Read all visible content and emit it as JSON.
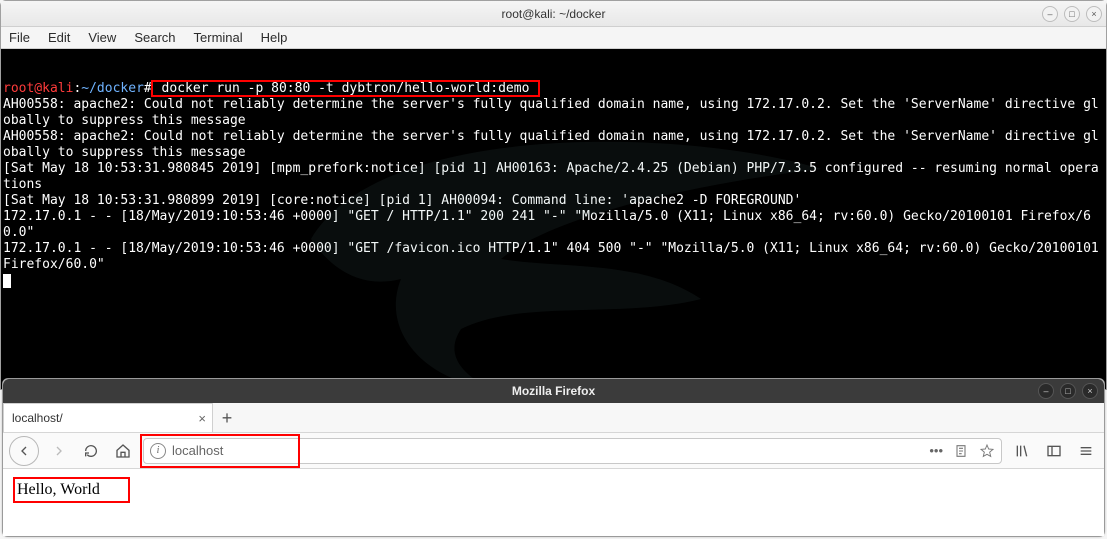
{
  "terminal": {
    "title": "root@kali: ~/docker",
    "menu": [
      "File",
      "Edit",
      "View",
      "Search",
      "Terminal",
      "Help"
    ],
    "prompt": {
      "user": "root@kali",
      "colon": ":",
      "path": "~/docker",
      "hash": "#"
    },
    "command": " docker run -p 80:80 -t dybtron/hello-world:demo ",
    "output_lines": [
      "AH00558: apache2: Could not reliably determine the server's fully qualified domain name, using 172.17.0.2. Set the 'ServerName' directive globally to suppress this message",
      "AH00558: apache2: Could not reliably determine the server's fully qualified domain name, using 172.17.0.2. Set the 'ServerName' directive globally to suppress this message",
      "[Sat May 18 10:53:31.980845 2019] [mpm_prefork:notice] [pid 1] AH00163: Apache/2.4.25 (Debian) PHP/7.3.5 configured -- resuming normal operations",
      "[Sat May 18 10:53:31.980899 2019] [core:notice] [pid 1] AH00094: Command line: 'apache2 -D FOREGROUND'",
      "172.17.0.1 - - [18/May/2019:10:53:46 +0000] \"GET / HTTP/1.1\" 200 241 \"-\" \"Mozilla/5.0 (X11; Linux x86_64; rv:60.0) Gecko/20100101 Firefox/60.0\"",
      "172.17.0.1 - - [18/May/2019:10:53:46 +0000] \"GET /favicon.ico HTTP/1.1\" 404 500 \"-\" \"Mozilla/5.0 (X11; Linux x86_64; rv:60.0) Gecko/20100101 Firefox/60.0\""
    ]
  },
  "firefox": {
    "title": "Mozilla Firefox",
    "tab_label": "localhost/",
    "url": "localhost",
    "url_actions_more": "•••",
    "page_text": "Hello, World"
  },
  "icons": {
    "minimize": "–",
    "maximize": "□",
    "close": "×",
    "newtab": "+",
    "home": "⌂"
  }
}
